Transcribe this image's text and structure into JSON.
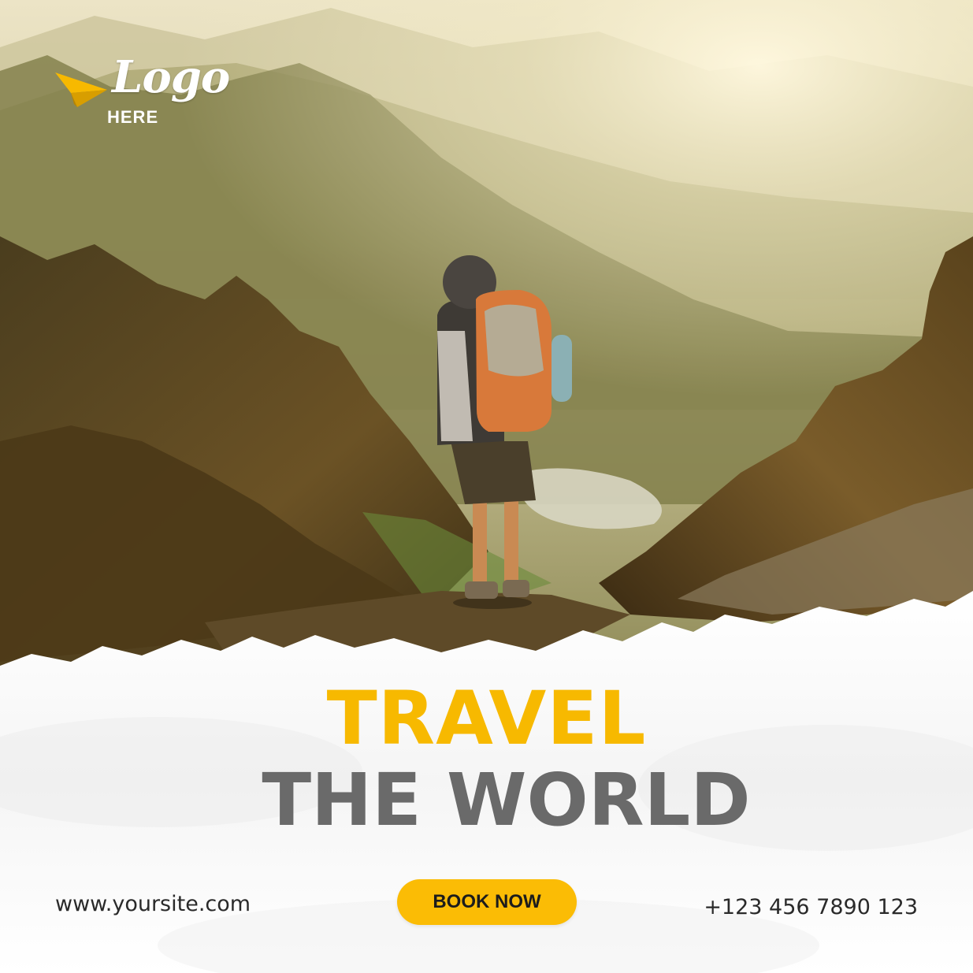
{
  "logo": {
    "script": "Logo",
    "here": "HERE"
  },
  "headline": {
    "line1": "TRAVEL",
    "line2": "THE WORLD"
  },
  "footer": {
    "website": "www.yoursite.com",
    "phone": "+123 456 7890 123"
  },
  "cta": {
    "label": "BOOK NOW"
  },
  "icons": {
    "logo_mark": "paper-plane-icon"
  },
  "colors": {
    "accent": "#fbbc05",
    "headline_primary": "#f7b900",
    "headline_secondary": "#6a6a6a",
    "text": "#2a2a2a"
  }
}
